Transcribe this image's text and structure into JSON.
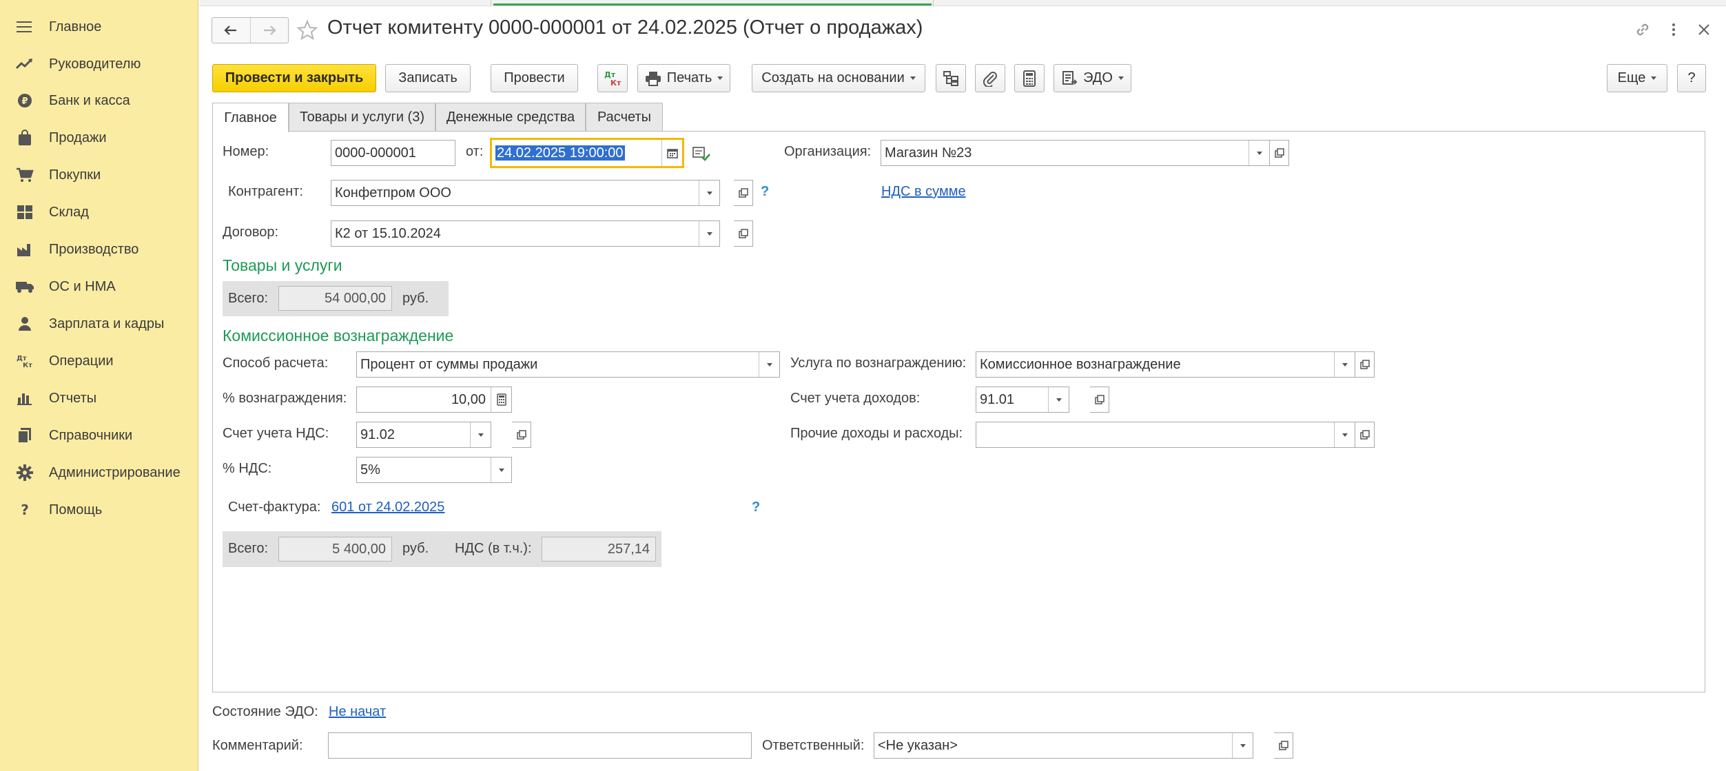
{
  "sidebar": {
    "items": [
      {
        "label": "Главное",
        "icon": "menu-lines-icon"
      },
      {
        "label": "Руководителю",
        "icon": "trend-chart-icon"
      },
      {
        "label": "Банк и касса",
        "icon": "ruble-coin-icon"
      },
      {
        "label": "Продажи",
        "icon": "shopping-bag-icon"
      },
      {
        "label": "Покупки",
        "icon": "shopping-cart-icon"
      },
      {
        "label": "Склад",
        "icon": "warehouse-grid-icon"
      },
      {
        "label": "Производство",
        "icon": "factory-icon"
      },
      {
        "label": "ОС и НМА",
        "icon": "truck-icon"
      },
      {
        "label": "Зарплата и кадры",
        "icon": "person-icon"
      },
      {
        "label": "Операции",
        "icon": "dt-kt-icon"
      },
      {
        "label": "Отчеты",
        "icon": "bar-chart-icon"
      },
      {
        "label": "Справочники",
        "icon": "books-icon"
      },
      {
        "label": "Администрирование",
        "icon": "gear-icon"
      },
      {
        "label": "Помощь",
        "icon": "question-icon"
      }
    ]
  },
  "header": {
    "title": "Отчет комитенту 0000-000001 от 24.02.2025 (Отчет о продажах)"
  },
  "toolbar": {
    "post_close": "Провести и закрыть",
    "save": "Записать",
    "post": "Провести",
    "print": "Печать",
    "create_based": "Создать на основании",
    "edo": "ЭДО",
    "more": "Еще",
    "help": "?"
  },
  "tabs": [
    {
      "label": "Главное",
      "active": true
    },
    {
      "label": "Товары и услуги (3)",
      "active": false
    },
    {
      "label": "Денежные средства",
      "active": false
    },
    {
      "label": "Расчеты",
      "active": false
    }
  ],
  "form": {
    "number_label": "Номер:",
    "number_value": "0000-000001",
    "date_label": "от:",
    "date_value": "24.02.2025 19:00:00",
    "org_label": "Организация:",
    "org_value": "Магазин №23",
    "counterparty_label": "Контрагент:",
    "counterparty_value": "Конфетпром ООО",
    "vat_link": "НДС в сумме",
    "contract_label": "Договор:",
    "contract_value": "К2 от 15.10.2024",
    "goods_section": "Товары и услуги",
    "total_label": "Всего:",
    "goods_total": "54 000,00",
    "currency": "руб.",
    "commission_section": "Комиссионное вознаграждение",
    "calc_method_label": "Способ расчета:",
    "calc_method_value": "Процент от суммы продажи",
    "service_label": "Услуга по вознаграждению:",
    "service_value": "Комиссионное вознаграждение",
    "percent_label": "% вознаграждения:",
    "percent_value": "10,00",
    "income_account_label": "Счет учета доходов:",
    "income_account_value": "91.01",
    "vat_account_label": "Счет учета НДС:",
    "vat_account_value": "91.02",
    "other_income_label": "Прочие доходы и расходы:",
    "other_income_value": "",
    "vat_rate_label": "% НДС:",
    "vat_rate_value": "5%",
    "invoice_label": "Счет-фактура:",
    "invoice_link": "601 от 24.02.2025",
    "commission_total": "5 400,00",
    "vat_incl_label": "НДС (в т.ч.):",
    "vat_incl_value": "257,14",
    "help_mark": "?"
  },
  "footer": {
    "edo_state_label": "Состояние ЭДО:",
    "edo_state_link": "Не начат",
    "comment_label": "Комментарий:",
    "comment_value": "",
    "responsible_label": "Ответственный:",
    "responsible_value": "<Не указан>"
  },
  "colors": {
    "sidebar_bg": "#fbeca3",
    "primary_button": "#f7cf00",
    "section_green": "#1d9a55",
    "link_blue": "#1f5fbf",
    "focus_border": "#f5b800"
  }
}
